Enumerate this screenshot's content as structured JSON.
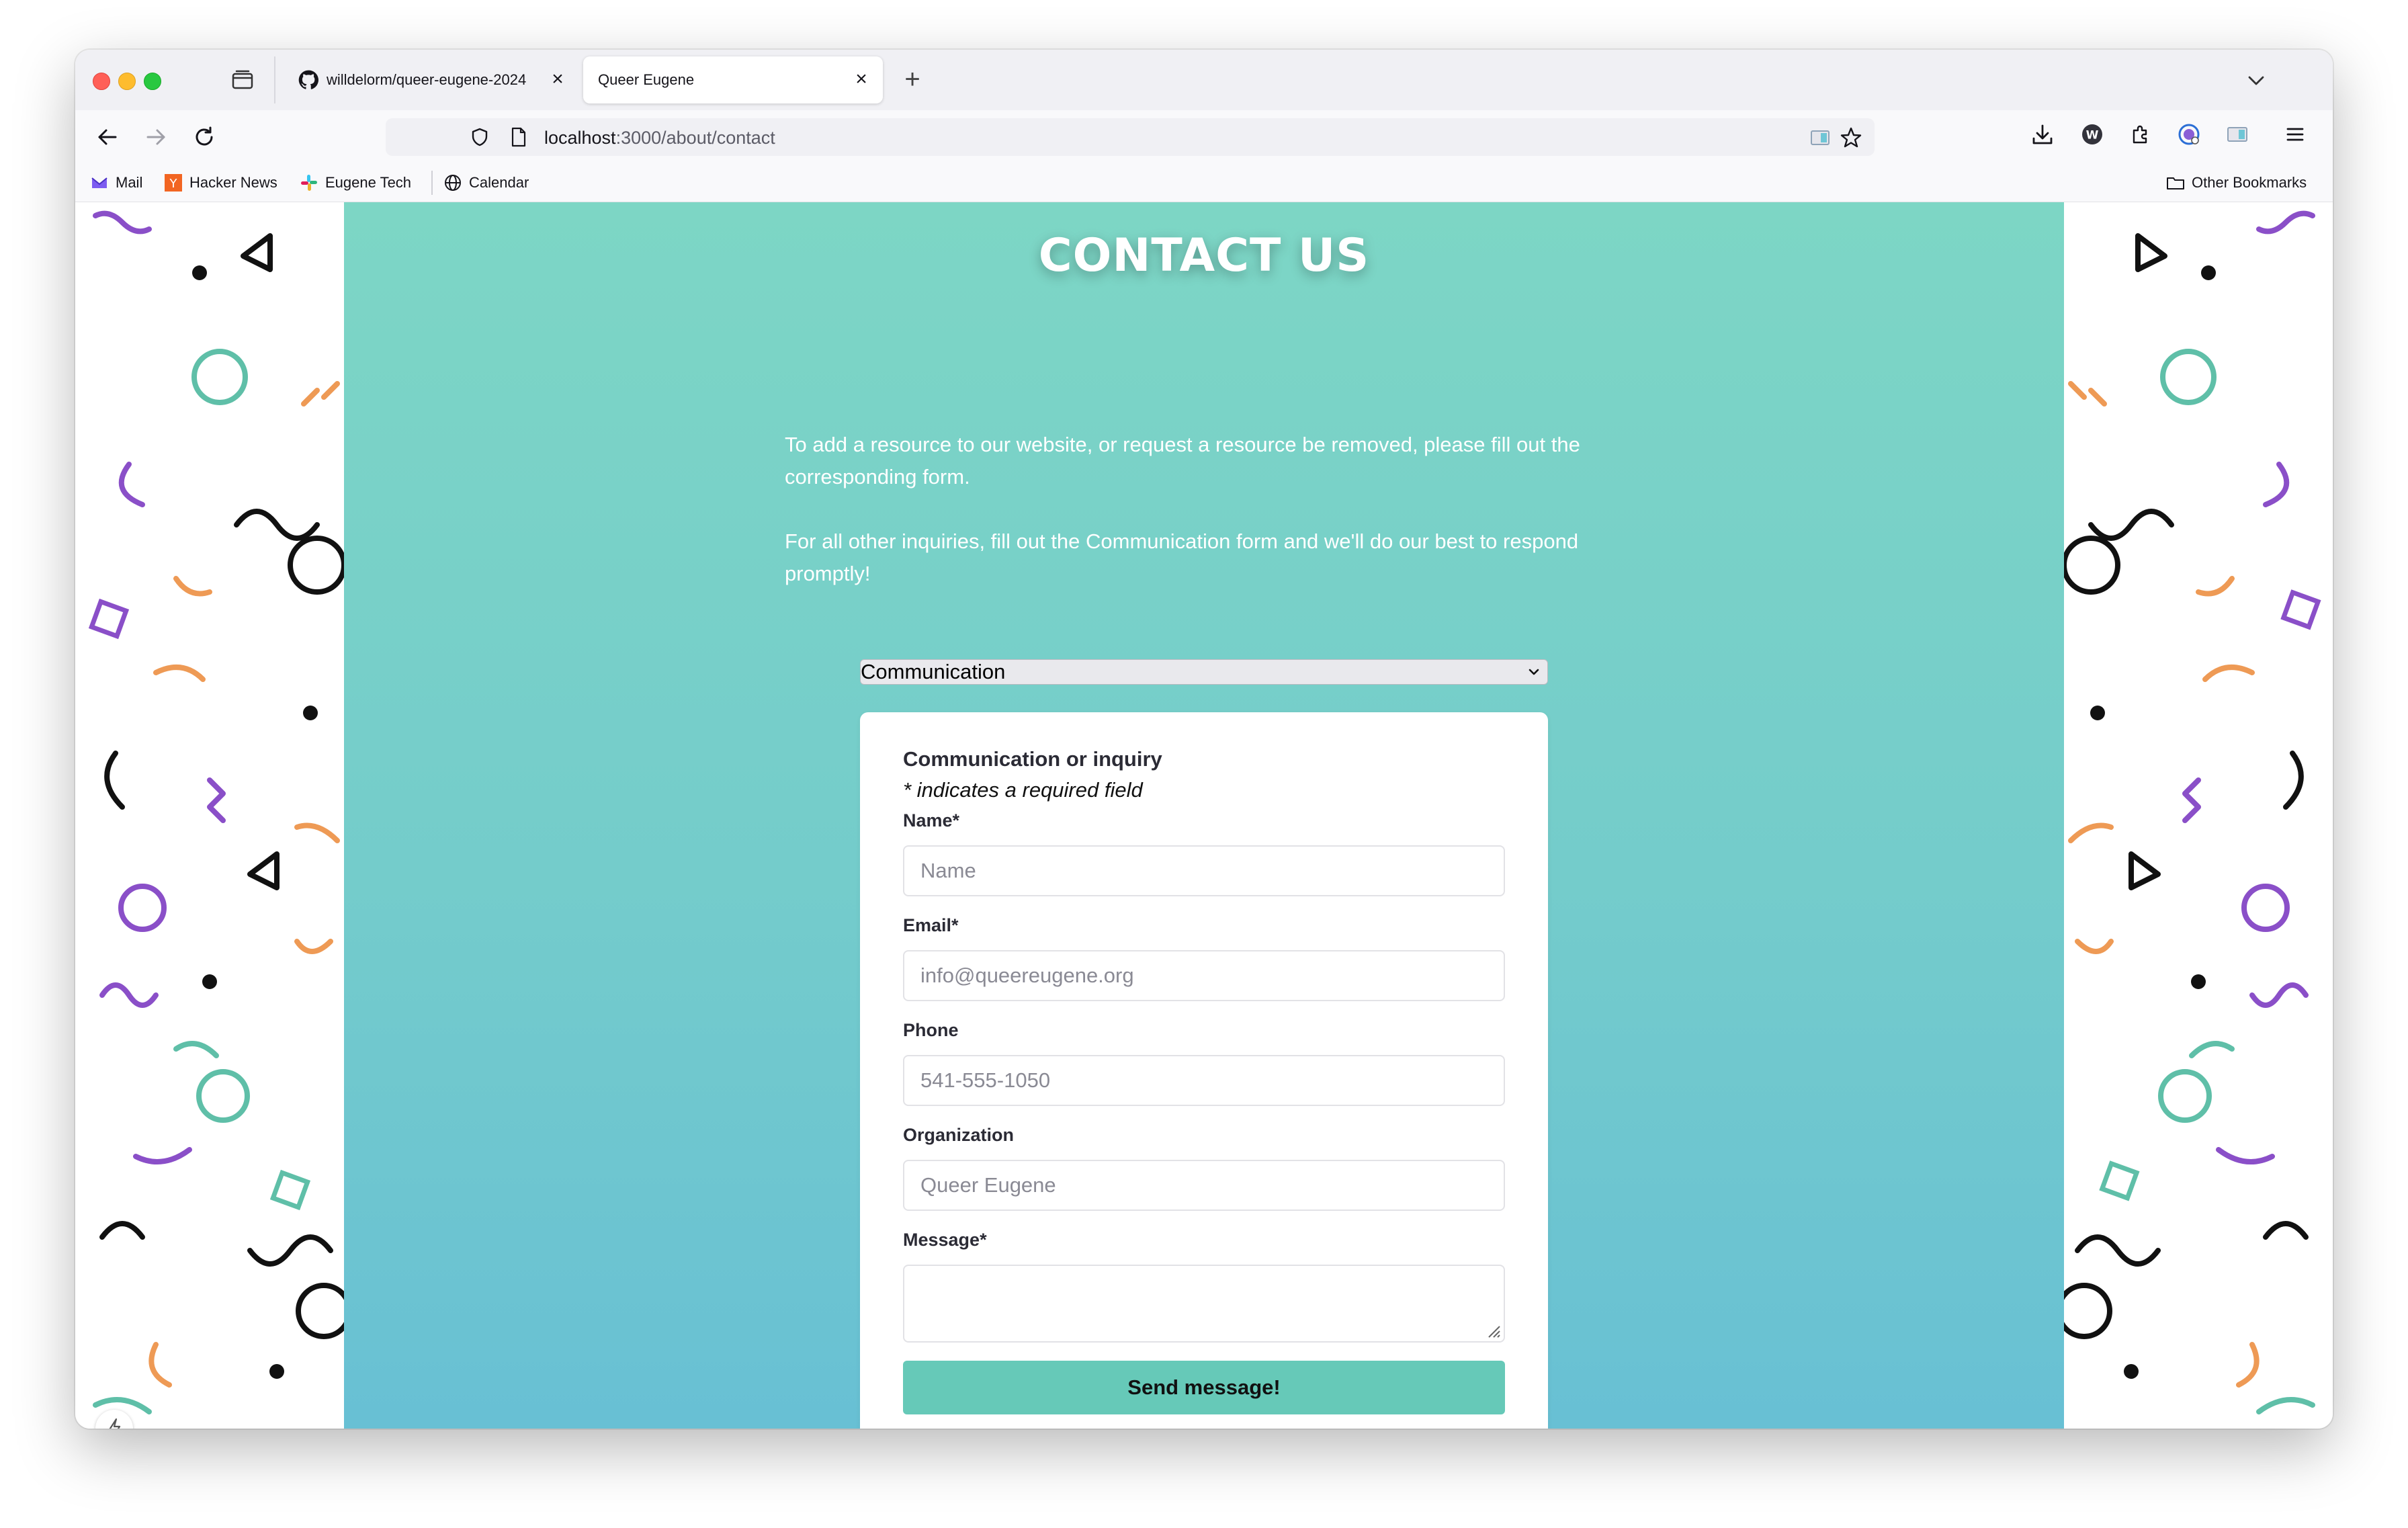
{
  "browser": {
    "tabs": [
      {
        "label": "willdelorm/queer-eugene-2024",
        "close": "×"
      },
      {
        "label": "Queer Eugene",
        "close": "×"
      }
    ],
    "new_tab": "+",
    "url": {
      "host": "localhost",
      "path": ":3000/about/contact"
    },
    "bookmarks": [
      "Mail",
      "Hacker News",
      "Eugene Tech",
      "Calendar"
    ],
    "other_bookmarks": "Other Bookmarks"
  },
  "page": {
    "title": "CONTACT US",
    "intro_1": "To add a resource to our website, or request a resource be removed, please fill out the corresponding form.",
    "intro_2": "For all other inquiries, fill out the Communication form and we'll do our best to respond promptly!",
    "form_select": "Communication",
    "form": {
      "title": "Communication or inquiry",
      "required_note": "* indicates a required field",
      "name_label": "Name*",
      "name_placeholder": "Name",
      "email_label": "Email*",
      "email_placeholder": "info@queereugene.org",
      "phone_label": "Phone",
      "phone_placeholder": "541-555-1050",
      "org_label": "Organization",
      "org_placeholder": "Queer Eugene",
      "message_label": "Message*",
      "submit_label": "Send message!"
    }
  },
  "colors": {
    "accent_teal": "#7dd6c5",
    "button_teal": "#66c9b8",
    "pattern_purple": "#8a4fc8",
    "pattern_orange": "#ee9a55",
    "pattern_teal": "#5fbfa8"
  },
  "icons": [
    "back-icon",
    "forward-icon",
    "reload-icon",
    "shield-icon",
    "page-icon",
    "reader-icon",
    "star-icon",
    "download-icon",
    "wordpress-icon",
    "extensions-icon",
    "account-icon",
    "sidebar-icon",
    "menu-icon",
    "github-icon",
    "tab-view-icon",
    "chevron-down-icon",
    "folder-icon",
    "bolt-icon"
  ]
}
